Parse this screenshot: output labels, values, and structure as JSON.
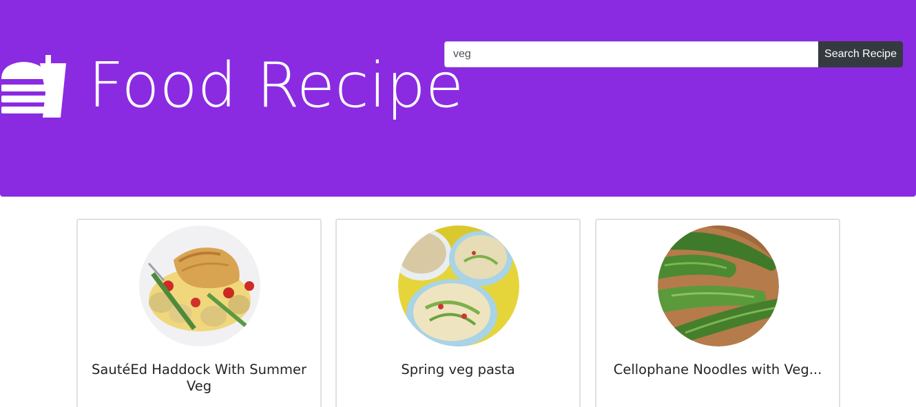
{
  "colors": {
    "header_bg": "#8a2be2",
    "button_bg": "#343a40",
    "card_border": "#e0e0e0"
  },
  "header": {
    "logo_icon": "fast-food-icon",
    "title": "Food Recipe"
  },
  "search": {
    "value": "veg",
    "button_label": "Search Recipe"
  },
  "recipes": [
    {
      "title": "SautéEd Haddock With Summer Veg",
      "image": "haddock-dish-image"
    },
    {
      "title": "Spring veg pasta",
      "image": "pasta-bowls-image"
    },
    {
      "title": "Cellophane Noodles with Veg...",
      "image": "courgettes-image"
    }
  ]
}
